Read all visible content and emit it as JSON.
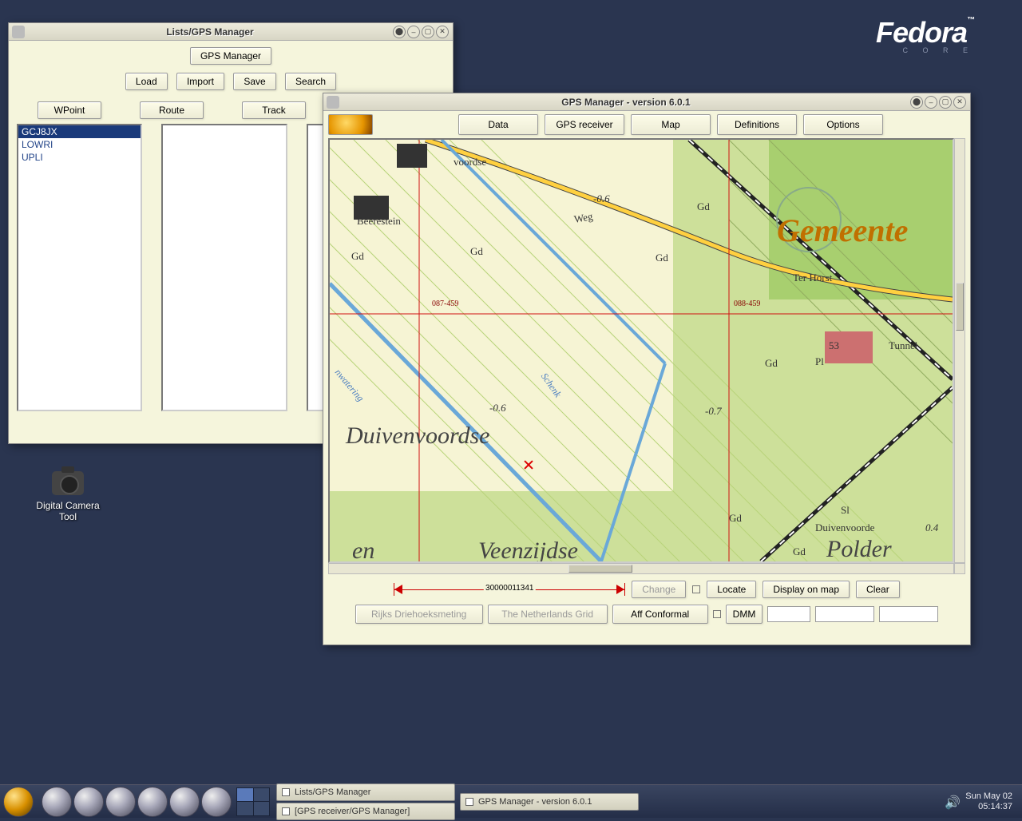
{
  "logo": {
    "brand": "Fedora",
    "sub": "C O R E"
  },
  "desktop": {
    "camera_tool": "Digital Camera Tool"
  },
  "win_lists": {
    "title": "Lists/GPS Manager",
    "gps_manager_btn": "GPS Manager",
    "actions": {
      "load": "Load",
      "import": "Import",
      "save": "Save",
      "search": "Search"
    },
    "cats": {
      "wpoint": "WPoint",
      "route": "Route",
      "track": "Track"
    },
    "wpoints": [
      "GCJ8JX",
      "LOWRI",
      "UPLI"
    ]
  },
  "win_map": {
    "title": "GPS Manager - version 6.0.1",
    "menu": {
      "data": "Data",
      "gpsrec": "GPS receiver",
      "map": "Map",
      "defs": "Definitions",
      "opts": "Options"
    },
    "scale_value": "30000011341",
    "buttons": {
      "change": "Change",
      "locate": "Locate",
      "display": "Display on map",
      "clear": "Clear"
    },
    "row2": {
      "datum": "Rijks Driehoeksmeting",
      "grid": "The Netherlands Grid",
      "proj": "Aff Conformal",
      "dmm": "DMM"
    },
    "map_labels": {
      "duiven": "Duivenvoordse",
      "veen": "Veenzijdse",
      "gemeente": "Gemeente",
      "polder": "Polder",
      "beerestein": "Beerestein",
      "terhorst": "Ter Horst",
      "tunnel": "Tunnel",
      "duivenvoorde": "Duivenvoorde",
      "voordse_frag": "voordse",
      "en_frag": "en",
      "weg": "Weg",
      "schenk": "Schenk",
      "nwatering": "nwatering",
      "grid_087": "087-459",
      "grid_088": "088-459",
      "gd": "Gd",
      "pl": "Pl",
      "sl": "Sl",
      "n53": "53",
      "neg06": "-0.6",
      "neg07": "-0.7",
      "pos04": "0.4"
    }
  },
  "taskbar": {
    "task1": "Lists/GPS Manager",
    "task2": "GPS Manager - version 6.0.1",
    "task3": "[GPS receiver/GPS Manager]",
    "date": "Sun May 02",
    "time": "05:14:37"
  }
}
